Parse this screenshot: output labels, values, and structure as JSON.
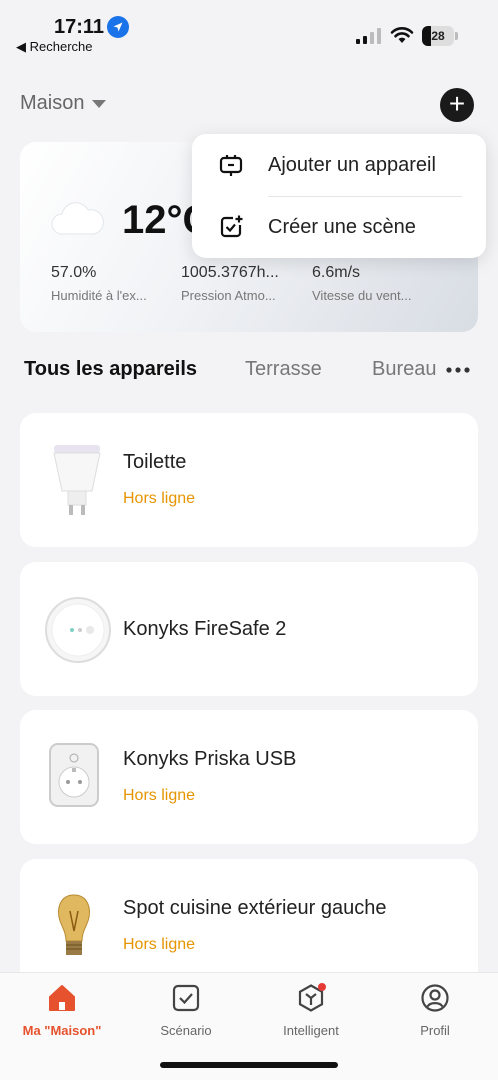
{
  "status_bar": {
    "time": "17:11",
    "back_label": "◀ Recherche",
    "battery": "28"
  },
  "header": {
    "home_name": "Maison",
    "add_icon": "plus-icon"
  },
  "weather": {
    "temperature": "12°C",
    "icon": "cloud-icon",
    "stats": [
      {
        "value": "57.0%",
        "label": "Humidité à l'ex..."
      },
      {
        "value": "1005.3767h...",
        "label": "Pression Atmo..."
      },
      {
        "value": "6.6m/s",
        "label": "Vitesse du vent..."
      }
    ]
  },
  "menu": {
    "items": [
      {
        "label": "Ajouter un appareil",
        "icon": "add-device-icon"
      },
      {
        "label": "Créer une scène",
        "icon": "create-scene-icon"
      }
    ]
  },
  "tabs": {
    "items": [
      "Tous les appareils",
      "Terrasse",
      "Bureau"
    ],
    "active": "Tous les appareils"
  },
  "devices": [
    {
      "name": "Toilette",
      "status": "Hors ligne",
      "icon": "bulb-gu10-icon"
    },
    {
      "name": "Konyks FireSafe 2",
      "status": "",
      "icon": "smoke-detector-icon"
    },
    {
      "name": "Konyks Priska USB",
      "status": "Hors ligne",
      "icon": "smart-plug-icon"
    },
    {
      "name": "Spot cuisine extérieur gauche",
      "status": "Hors ligne",
      "icon": "edison-bulb-icon"
    }
  ],
  "bottom_nav": {
    "items": [
      {
        "label": "Ma \"Maison\"",
        "icon": "home-icon",
        "active": true
      },
      {
        "label": "Scénario",
        "icon": "scenario-icon",
        "active": false
      },
      {
        "label": "Intelligent",
        "icon": "intelligent-icon",
        "active": false
      },
      {
        "label": "Profil",
        "icon": "profile-icon",
        "active": false
      }
    ]
  },
  "colors": {
    "accent": "#e5522d",
    "offline": "#e69500",
    "background": "#f3f3f5"
  }
}
